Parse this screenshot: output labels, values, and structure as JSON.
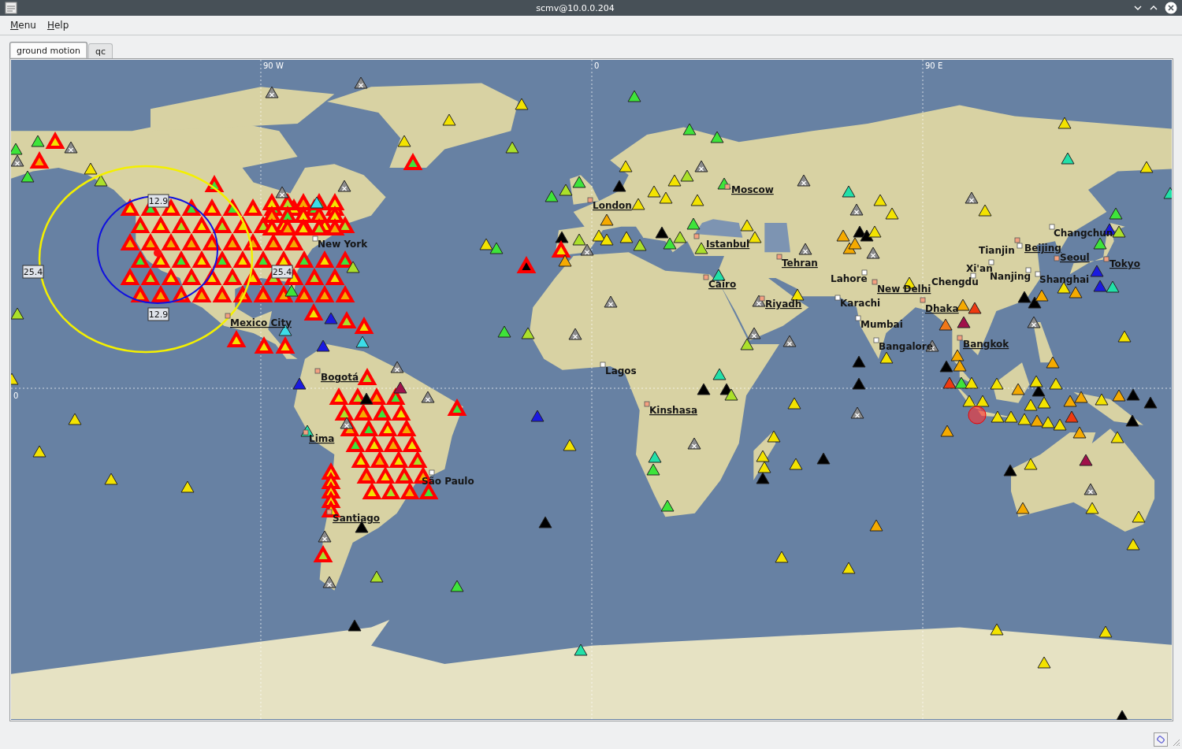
{
  "window": {
    "title": "scmv@10.0.0.204"
  },
  "menu_bar": [
    {
      "label": "Menu"
    },
    {
      "label": "Help"
    }
  ],
  "tabs": [
    {
      "label": "ground motion",
      "selected": true
    },
    {
      "label": "qc",
      "selected": false
    }
  ],
  "map": {
    "grid_labels": [
      "90 W",
      "0",
      "90 E",
      "0"
    ],
    "distance_labels": [
      "12.9",
      "25.4",
      "25.4",
      "12.9"
    ],
    "cities": [
      {
        "name": "Moscow",
        "capital": true
      },
      {
        "name": "London",
        "capital": true
      },
      {
        "name": "Changchun",
        "capital": false
      },
      {
        "name": "New York",
        "capital": false
      },
      {
        "name": "Istanbul",
        "capital": true
      },
      {
        "name": "Tianjin",
        "capital": false
      },
      {
        "name": "Beijing",
        "capital": true
      },
      {
        "name": "Seoul",
        "capital": true
      },
      {
        "name": "Tehran",
        "capital": true
      },
      {
        "name": "Tokyo",
        "capital": true
      },
      {
        "name": "Xi'an",
        "capital": false
      },
      {
        "name": "Lahore",
        "capital": false
      },
      {
        "name": "Nanjing",
        "capital": false
      },
      {
        "name": "Cairo",
        "capital": true
      },
      {
        "name": "Chengdu",
        "capital": false
      },
      {
        "name": "Shanghai",
        "capital": false
      },
      {
        "name": "New Delhi",
        "capital": true
      },
      {
        "name": "Karachi",
        "capital": false
      },
      {
        "name": "Riyadh",
        "capital": true
      },
      {
        "name": "Dhaka",
        "capital": true
      },
      {
        "name": "Mexico City",
        "capital": true
      },
      {
        "name": "Mumbai",
        "capital": false
      },
      {
        "name": "Bangkok",
        "capital": true
      },
      {
        "name": "Bangalore",
        "capital": false
      },
      {
        "name": "Lagos",
        "capital": false
      },
      {
        "name": "Bogotá",
        "capital": true
      },
      {
        "name": "Kinshasa",
        "capital": true
      },
      {
        "name": "Lima",
        "capital": true
      },
      {
        "name": "São Paulo",
        "capital": false
      },
      {
        "name": "Santiago",
        "capital": true
      }
    ]
  }
}
